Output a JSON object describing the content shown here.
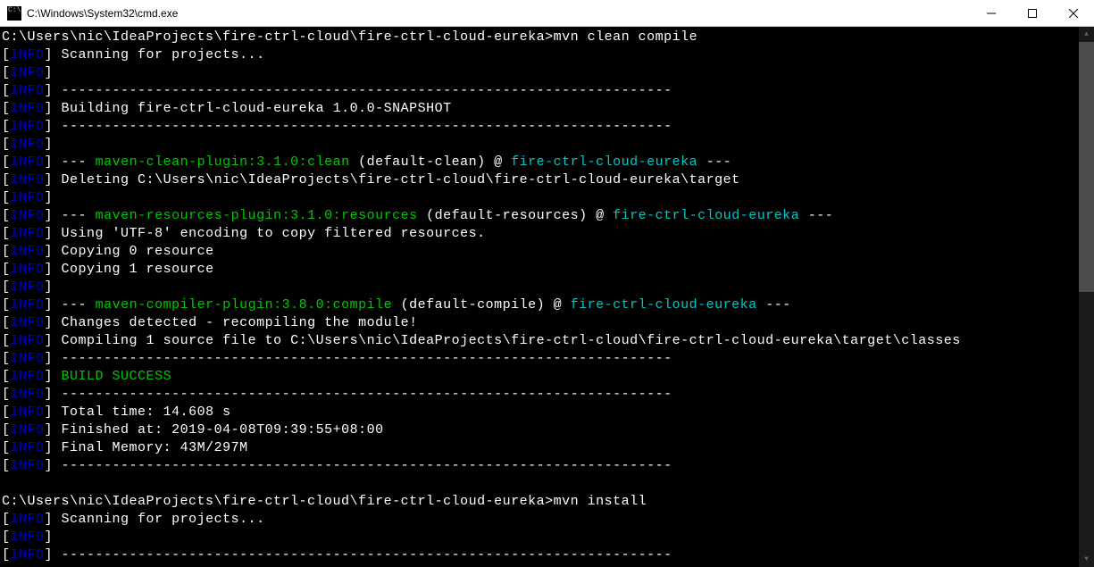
{
  "window": {
    "title": "C:\\Windows\\System32\\cmd.exe"
  },
  "colors": {
    "info": "#0000c8",
    "plugin": "#00c800",
    "project": "#00c8c8",
    "success": "#00c800",
    "text": "#ffffff",
    "bg": "#000000"
  },
  "prompt1_path": "C:\\Users\\nic\\IdeaProjects\\fire-ctrl-cloud\\fire-ctrl-cloud-eureka>",
  "prompt1_cmd": "mvn clean compile",
  "info_label": "INFO",
  "scanning": "Scanning for projects...",
  "divider_long": "------------------------------------------------------------------------",
  "building": "Building fire-ctrl-cloud-eureka 1.0.0-SNAPSHOT",
  "dash3": "--- ",
  "dash3_end": " ---",
  "clean_plugin": "maven-clean-plugin:3.1.0:clean",
  "clean_goal": " (default-clean) @ ",
  "project_name": "fire-ctrl-cloud-eureka",
  "deleting": "Deleting C:\\Users\\nic\\IdeaProjects\\fire-ctrl-cloud\\fire-ctrl-cloud-eureka\\target",
  "resources_plugin": "maven-resources-plugin:3.1.0:resources",
  "resources_goal": " (default-resources) @ ",
  "utf8": "Using 'UTF-8' encoding to copy filtered resources.",
  "copy0": "Copying 0 resource",
  "copy1": "Copying 1 resource",
  "compiler_plugin": "maven-compiler-plugin:3.8.0:compile",
  "compiler_goal": " (default-compile) @ ",
  "changes": "Changes detected - recompiling the module!",
  "compiling": "Compiling 1 source file to C:\\Users\\nic\\IdeaProjects\\fire-ctrl-cloud\\fire-ctrl-cloud-eureka\\target\\classes",
  "build_success": "BUILD SUCCESS",
  "total_time": "Total time: 14.608 s",
  "finished_at": "Finished at: 2019-04-08T09:39:55+08:00",
  "final_memory": "Final Memory: 43M/297M",
  "prompt2_path": "C:\\Users\\nic\\IdeaProjects\\fire-ctrl-cloud\\fire-ctrl-cloud-eureka>",
  "prompt2_cmd": "mvn install"
}
